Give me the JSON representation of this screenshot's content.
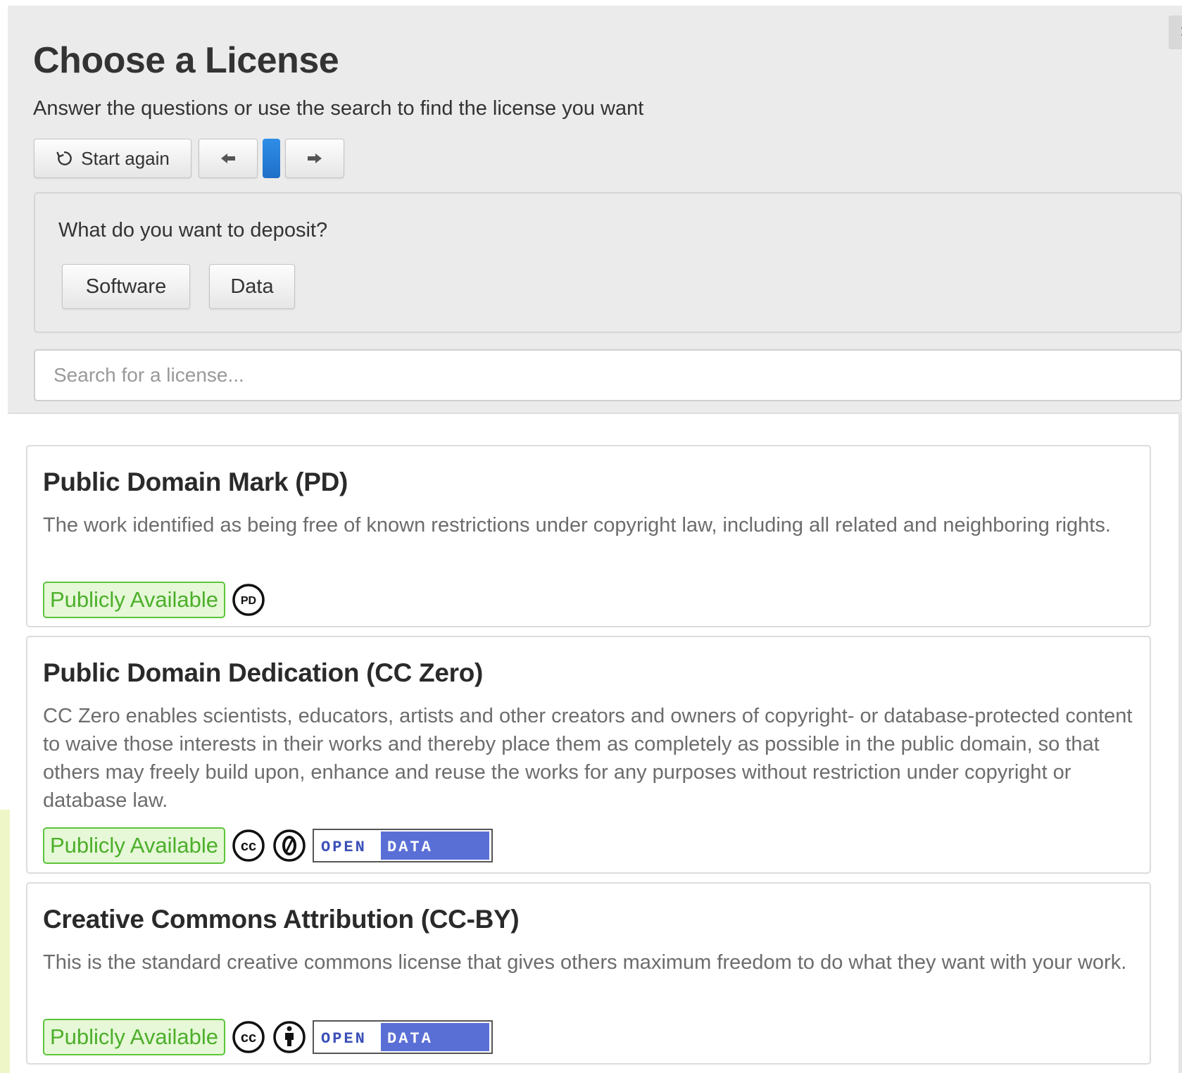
{
  "dialog": {
    "close_label": "×",
    "title": "Choose a License",
    "subtitle": "Answer the questions or use the search to find the license you want"
  },
  "toolbar": {
    "start_again_label": "Start again",
    "start_again_icon": "refresh-icon",
    "prev_icon": "arrow-left-icon",
    "next_icon": "arrow-right-icon"
  },
  "question": {
    "text": "What do you want to deposit?",
    "options": [
      "Software",
      "Data"
    ]
  },
  "search": {
    "placeholder": "Search for a license...",
    "value": ""
  },
  "licenses": [
    {
      "title": "Public Domain Mark (PD)",
      "description": "The work identified as being free of known restrictions under copyright law, including all related and neighboring rights.",
      "availability": "Publicly Available",
      "icons": [
        "pd-icon"
      ]
    },
    {
      "title": "Public Domain Dedication (CC Zero)",
      "description": "CC Zero enables scientists, educators, artists and other creators and owners of copyright- or database-protected content to waive those interests in their works and thereby place them as completely as possible in the public domain, so that others may freely build upon, enhance and reuse the works for any purposes without restriction under copyright or database law.",
      "availability": "Publicly Available",
      "icons": [
        "cc-icon",
        "zero-icon",
        "open-data-badge"
      ]
    },
    {
      "title": "Creative Commons Attribution (CC-BY)",
      "description": "This is the standard creative commons license that gives others maximum freedom to do what they want with your work.",
      "availability": "Publicly Available",
      "icons": [
        "cc-icon",
        "attribution-icon",
        "open-data-badge"
      ]
    }
  ],
  "open_data_badge": {
    "left_text": "OPEN",
    "right_text": "DATA"
  },
  "icon_labels": {
    "pd": "PD",
    "cc": "cc",
    "zero": "0"
  },
  "colors": {
    "available_green": "#4caf2a",
    "progress_blue": "#1f6fc7",
    "open_data_blue": "#5a6fd6"
  }
}
